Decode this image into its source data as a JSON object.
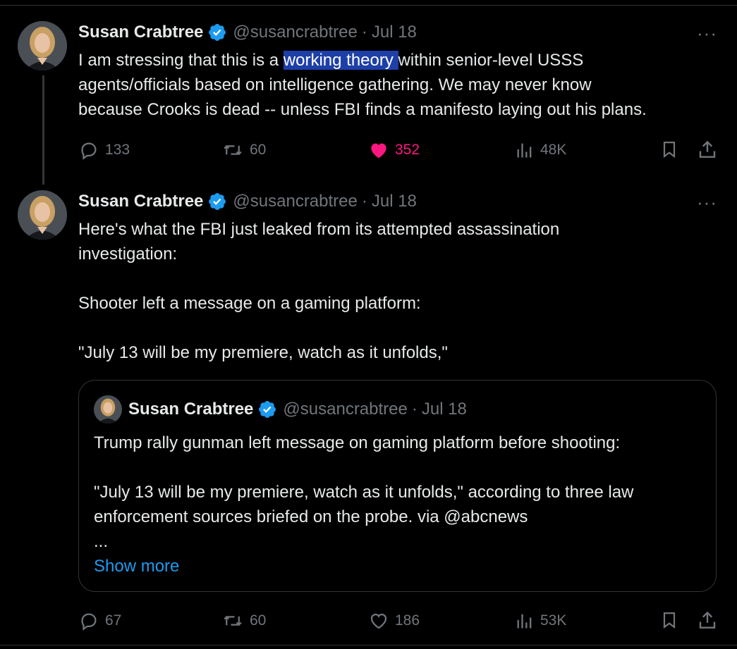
{
  "tweet1": {
    "author_name": "Susan Crabtree",
    "handle": "@susancrabtree",
    "separator": "·",
    "date": "Jul 18",
    "more": "···",
    "text_line1_before": "I am stressing that this is a ",
    "text_line1_highlight": "working theory ",
    "text_line1_after": "within senior-level USSS",
    "text_line2": "agents/officials based on intelligence gathering. We may never know",
    "text_line3": "because Crooks is dead -- unless FBI finds a manifesto laying out his plans.",
    "replies": "133",
    "reposts": "60",
    "likes": "352",
    "views": "48K"
  },
  "tweet2": {
    "author_name": "Susan Crabtree",
    "handle": "@susancrabtree",
    "separator": "·",
    "date": "Jul 18",
    "more": "···",
    "text_line1": "Here's what the FBI just leaked from its attempted assassination",
    "text_line2": "investigation:",
    "text_line3": "Shooter left a message on a gaming platform:",
    "text_line4": "\"July 13 will be my premiere, watch as it unfolds,\"",
    "replies": "67",
    "reposts": "60",
    "likes": "186",
    "views": "53K"
  },
  "quoted": {
    "author_name": "Susan Crabtree",
    "handle": "@susancrabtree",
    "separator": "·",
    "date": "Jul 18",
    "text_line1": "Trump rally gunman left message on gaming platform before shooting:",
    "text_line2": "\"July 13 will be my premiere, watch as it unfolds,\" according to three law",
    "text_line3": "enforcement sources briefed on the probe. via @abcnews",
    "ellipsis": "...",
    "show_more": "Show more"
  },
  "colors": {
    "background": "#000000",
    "text": "#e7e9ea",
    "muted": "#71767b",
    "verified": "#1d9bf0",
    "like_active": "#f91880",
    "highlight": "#1e3fa8"
  },
  "icons": [
    "reply-icon",
    "repost-icon",
    "like-icon",
    "views-icon",
    "bookmark-icon",
    "share-icon",
    "verified-badge-icon",
    "more-icon"
  ]
}
